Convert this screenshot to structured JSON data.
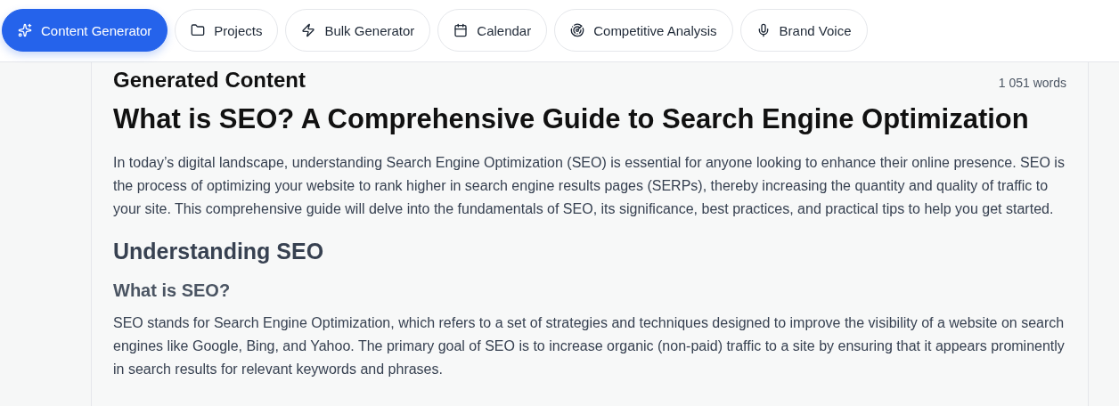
{
  "tabs": [
    {
      "label": "Content Generator",
      "kind": "sparkles",
      "selected": true
    },
    {
      "label": "Projects",
      "kind": "folder",
      "selected": false
    },
    {
      "label": "Bulk Generator",
      "kind": "zap",
      "selected": false
    },
    {
      "label": "Calendar",
      "kind": "calendar",
      "selected": false
    },
    {
      "label": "Competitive Analysis",
      "kind": "radar",
      "selected": false
    },
    {
      "label": "Brand Voice",
      "kind": "mic",
      "selected": false
    }
  ],
  "panel": {
    "title": "Generated Content",
    "word_count": "1 051 words",
    "article": [
      {
        "kind": "h1",
        "text": "What is SEO? A Comprehensive Guide to Search Engine Optimization"
      },
      {
        "kind": "p",
        "text": "In today’s digital landscape, understanding Search Engine Optimization (SEO) is essential for anyone looking to enhance their online presence. SEO is the process of optimizing your website to rank higher in search engine results pages (SERPs), thereby increasing the quantity and quality of traffic to your site. This comprehensive guide will delve into the fundamentals of SEO, its significance, best practices, and practical tips to help you get started."
      },
      {
        "kind": "h2",
        "text": "Understanding SEO"
      },
      {
        "kind": "h3",
        "text": "What is SEO?"
      },
      {
        "kind": "p",
        "text": "SEO stands for Search Engine Optimization, which refers to a set of strategies and techniques designed to improve the visibility of a website on search engines like Google, Bing, and Yahoo. The primary goal of SEO is to increase organic (non-paid) traffic to a site by ensuring that it appears prominently in search results for relevant keywords and phrases."
      }
    ]
  }
}
